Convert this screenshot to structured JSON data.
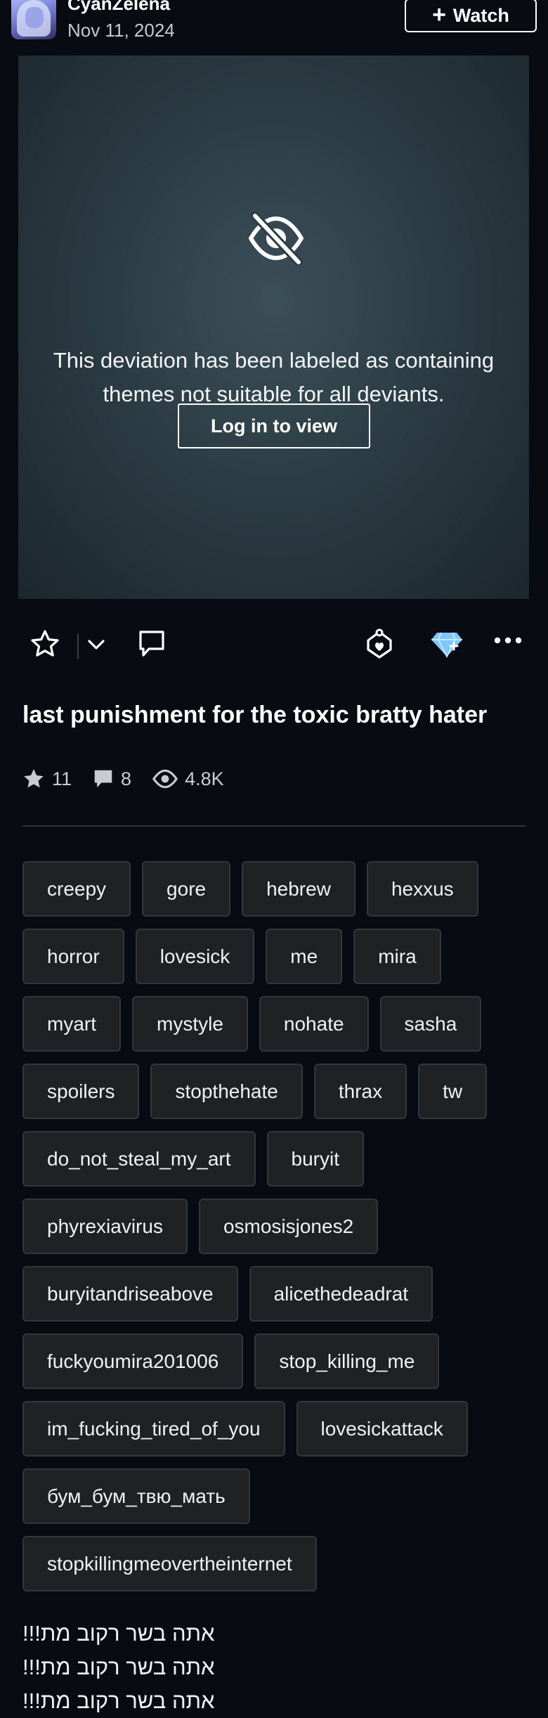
{
  "author": {
    "name": "CyanZelena",
    "date": "Nov 11, 2024",
    "watch_label": "Watch"
  },
  "preview": {
    "notice_line1": "This deviation has been labeled as containing",
    "notice_line2": "themes not suitable for all deviants.",
    "login_label": "Log in to view"
  },
  "actions": {
    "icons": [
      "star-icon",
      "chevron-down-icon",
      "comment-icon",
      "share-icon",
      "gem-icon",
      "more-icon"
    ]
  },
  "deviation": {
    "title": "last punishment for the toxic bratty hater",
    "stats": {
      "favourites": "11",
      "comments": "8",
      "views": "4.8K"
    }
  },
  "tags": [
    [
      "creepy",
      "gore",
      "hebrew",
      "hexxus"
    ],
    [
      "horror",
      "lovesick",
      "me",
      "mira"
    ],
    [
      "myart",
      "mystyle",
      "nohate",
      "sasha"
    ],
    [
      "spoilers",
      "stopthehate",
      "thrax",
      "tw"
    ],
    [
      "do_not_steal_my_art",
      "buryit"
    ],
    [
      "phyrexiavirus",
      "osmosisjones2"
    ],
    [
      "buryitandriseabove",
      "alicethedeadrat"
    ],
    [
      "fuckyoumira201006",
      "stop_killing_me"
    ],
    [
      "im_fucking_tired_of_you",
      "lovesickattack"
    ],
    [
      "бум_бум_твю_мать"
    ],
    [
      "stopkillingmeovertheinternet"
    ]
  ],
  "description": [
    "!!!אתה בשר רקוב מת",
    "!!!אתה בשר רקוב מת",
    "!!!אתה בשר רקוב מת"
  ],
  "colors": {
    "background": "#080b12",
    "tag_background": "#1f2125",
    "gem": "#7fc8ff"
  }
}
